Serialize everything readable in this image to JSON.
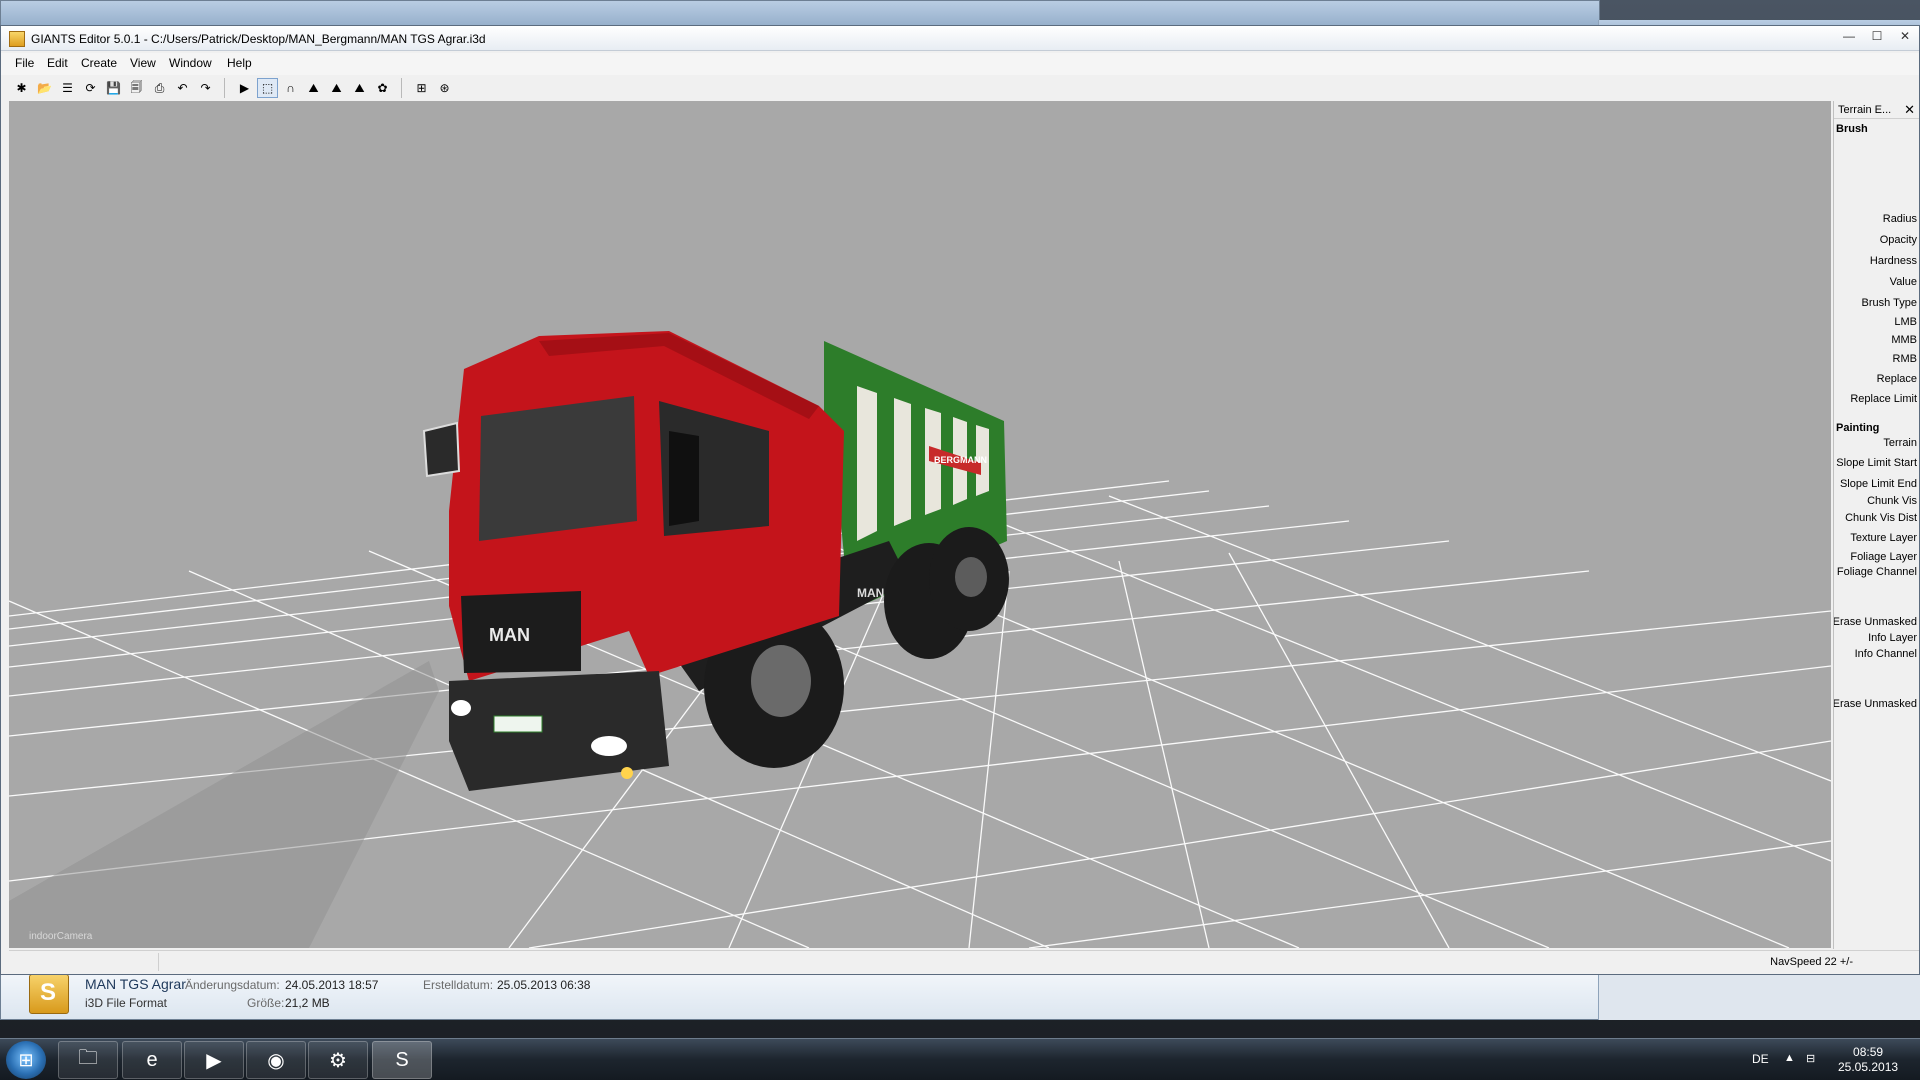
{
  "background_window": {
    "details": {
      "file_name": "MAN TGS Agrar",
      "file_type": "i3D File Format",
      "modified_label": "Änderungsdatum:",
      "modified_value": "24.05.2013 18:57",
      "created_label": "Erstelldatum:",
      "created_value": "25.05.2013 06:38",
      "size_label": "Größe:",
      "size_value": "21,2 MB"
    }
  },
  "editor": {
    "title": "GIANTS Editor 5.0.1 - C:/Users/Patrick/Desktop/MAN_Bergmann/MAN TGS Agrar.i3d",
    "window_controls": [
      "—",
      "☐",
      "✕"
    ],
    "menu": [
      "File",
      "Edit",
      "Create",
      "View",
      "Window",
      "Help"
    ],
    "toolbar": [
      {
        "name": "new-icon",
        "glyph": "✱"
      },
      {
        "name": "open-icon",
        "glyph": "📂"
      },
      {
        "name": "list-icon",
        "glyph": "☰"
      },
      {
        "name": "reload-icon",
        "glyph": "⟳"
      },
      {
        "name": "save-icon",
        "glyph": "💾"
      },
      {
        "name": "save-all-icon",
        "glyph": "🗐"
      },
      {
        "name": "export-icon",
        "glyph": "⎙"
      },
      {
        "name": "undo-icon",
        "glyph": "↶"
      },
      {
        "name": "redo-icon",
        "glyph": "↷"
      },
      {
        "name": "play-icon",
        "glyph": "▶"
      },
      {
        "name": "select-icon",
        "glyph": "⬚"
      },
      {
        "name": "terrain-sculpt-icon",
        "glyph": "∩"
      },
      {
        "name": "terrain-paint-icon",
        "glyph": "⛰"
      },
      {
        "name": "foliage-paint-icon",
        "glyph": "⛰"
      },
      {
        "name": "terrain-info-icon",
        "glyph": "⛰"
      },
      {
        "name": "grass-paint-icon",
        "glyph": "✿"
      },
      {
        "name": "navmesh-icon",
        "glyph": "⊞"
      },
      {
        "name": "navmesh-debug-icon",
        "glyph": "⊛"
      }
    ],
    "viewport": {
      "camera_label": "indoorCamera",
      "truck_cab_color": "#c4141b",
      "trailer_color": "#2d7d2a",
      "ground_color": "#a8a8a8",
      "grid_color": "#ffffff",
      "brand_text": "MAN",
      "trailer_brand": "BERGMANN"
    },
    "panel": {
      "title": "Terrain E...",
      "brush_section": "Brush",
      "brush_labels": [
        "Radius",
        "Opacity",
        "Hardness",
        "Value",
        "Brush Type",
        "LMB",
        "MMB",
        "RMB",
        "Replace",
        "Replace Limit"
      ],
      "painting_section": "Painting",
      "painting_labels": [
        "Terrain",
        "Slope Limit Start",
        "Slope Limit End",
        "Chunk Vis",
        "Chunk Vis Dist",
        "Texture Layer",
        "Foliage Layer",
        "Foliage Channel",
        "Erase Unmasked",
        "Info Layer",
        "Info Channel",
        "Erase Unmasked"
      ]
    },
    "status": {
      "navspeed": "NavSpeed 22 +/-"
    }
  },
  "taskbar": {
    "apps": [
      {
        "name": "explorer-icon",
        "glyph": "🗀"
      },
      {
        "name": "internet-explorer-icon",
        "glyph": "e"
      },
      {
        "name": "media-player-icon",
        "glyph": "▶"
      },
      {
        "name": "firefox-icon",
        "glyph": "◉"
      },
      {
        "name": "steam-icon",
        "glyph": "⚙"
      },
      {
        "name": "giants-editor-icon",
        "glyph": "S"
      }
    ],
    "language": "DE",
    "time": "08:59",
    "date": "25.05.2013"
  }
}
